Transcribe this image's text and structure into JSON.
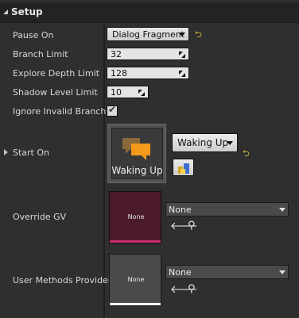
{
  "section": {
    "title": "Setup"
  },
  "rows": {
    "pause_on": {
      "label": "Pause On",
      "value": "Dialog Fragment"
    },
    "branch_limit": {
      "label": "Branch Limit",
      "value": "32"
    },
    "explore_depth": {
      "label": "Explore Depth Limit",
      "value": "128"
    },
    "shadow_level": {
      "label": "Shadow Level Limit",
      "value": "10"
    },
    "ignore_invalid": {
      "label": "Ignore Invalid Branches",
      "checked": true
    },
    "start_on": {
      "label": "Start On",
      "thumb_label": "Waking Up",
      "dropdown_value": "Waking Up"
    },
    "override_gv": {
      "label": "Override GV",
      "thumb_text": "None",
      "combo_value": "None",
      "accent": "#c8326e"
    },
    "user_methods": {
      "label": "User Methods Provider",
      "thumb_text": "None",
      "combo_value": "None",
      "accent": "#ffffff"
    }
  },
  "icons": {
    "reset": "reset-to-default-icon",
    "use": "use-selected-arrow-icon",
    "browse": "browse-search-icon",
    "dialog": "speech-bubbles-icon",
    "participants": "participants-icon"
  }
}
